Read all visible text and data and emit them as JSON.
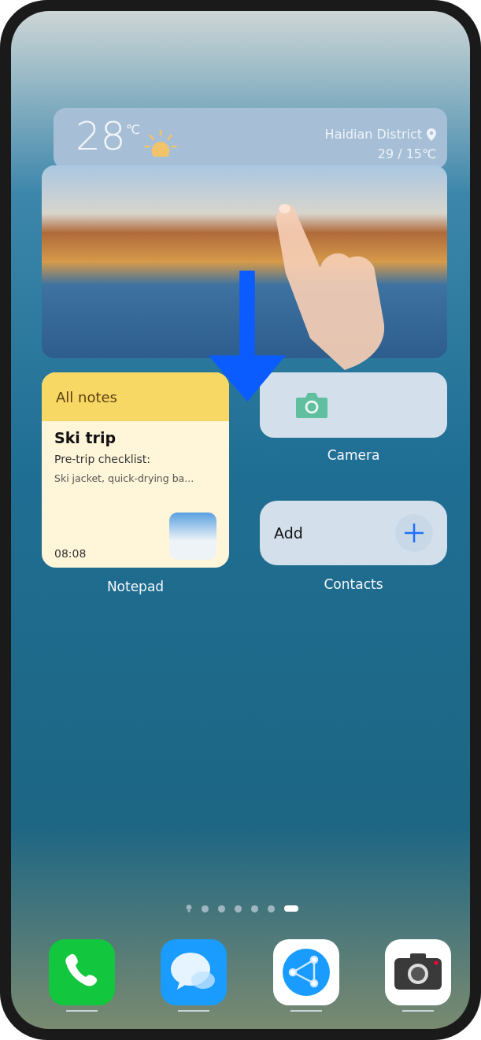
{
  "weather": {
    "temperature": "28",
    "unit": "℃",
    "location": "Haidian District",
    "range": "29 / 15℃"
  },
  "notes_widget": {
    "header": "All notes",
    "title": "Ski trip",
    "subtitle": "Pre-trip checklist:",
    "preview": "Ski jacket, quick-drying ba...",
    "time": "08:08",
    "label": "Notepad"
  },
  "camera_widget": {
    "label": "Camera"
  },
  "contacts_widget": {
    "action": "Add",
    "label": "Contacts"
  },
  "page_dots": [
    {
      "kind": "hint",
      "selected": false
    },
    {
      "kind": "page",
      "selected": false
    },
    {
      "kind": "page",
      "selected": false
    },
    {
      "kind": "page",
      "selected": false
    },
    {
      "kind": "page",
      "selected": false
    },
    {
      "kind": "page",
      "selected": false
    },
    {
      "kind": "page",
      "selected": true
    }
  ],
  "dock": [
    {
      "kind": "phone"
    },
    {
      "kind": "messages"
    },
    {
      "kind": "browser"
    },
    {
      "kind": "camera"
    }
  ]
}
